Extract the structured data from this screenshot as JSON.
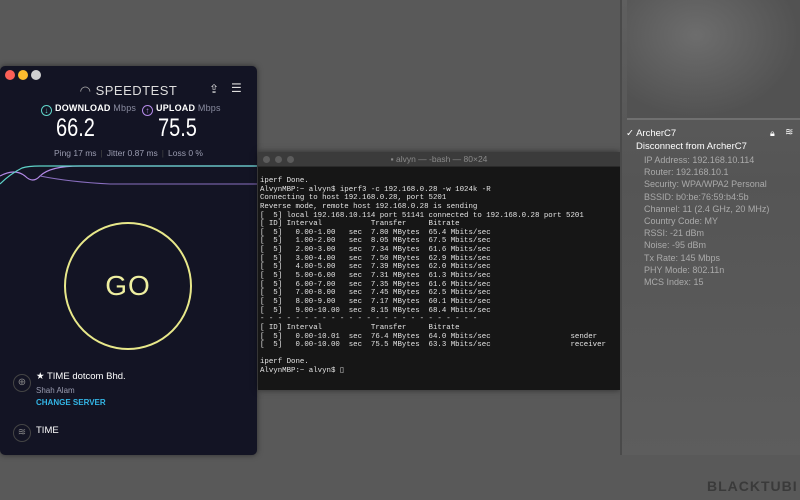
{
  "speedtest": {
    "title": "SPEEDTEST",
    "download_label": "DOWNLOAD",
    "download_unit": "Mbps",
    "download_value": "66.2",
    "upload_label": "UPLOAD",
    "upload_unit": "Mbps",
    "upload_value": "75.5",
    "ping": "Ping 17 ms",
    "jitter": "Jitter 0.87 ms",
    "loss": "Loss 0 %",
    "go_label": "GO",
    "server_name": "TIME dotcom Bhd.",
    "server_location": "Shah Alam",
    "change_server": "CHANGE SERVER",
    "isp": "TIME",
    "colors": {
      "download": "#5fd3c8",
      "upload": "#b48ae8",
      "go": "#e8e88a",
      "link": "#33b5e5"
    }
  },
  "terminal": {
    "title": "alvyn — -bash — 80×24",
    "lines": [
      "iperf Done.",
      "AlvynMBP:~ alvyn$ iperf3 -c 192.168.0.28 -w 1024k -R",
      "Connecting to host 192.168.0.28, port 5201",
      "Reverse mode, remote host 192.168.0.28 is sending",
      "[  5] local 192.168.10.114 port 51141 connected to 192.168.0.28 port 5201",
      "[ ID] Interval           Transfer     Bitrate",
      "[  5]   0.00-1.00   sec  7.80 MBytes  65.4 Mbits/sec",
      "[  5]   1.00-2.00   sec  8.05 MBytes  67.5 Mbits/sec",
      "[  5]   2.00-3.00   sec  7.34 MBytes  61.6 Mbits/sec",
      "[  5]   3.00-4.00   sec  7.50 MBytes  62.9 Mbits/sec",
      "[  5]   4.00-5.00   sec  7.39 MBytes  62.0 Mbits/sec",
      "[  5]   5.00-6.00   sec  7.31 MBytes  61.3 Mbits/sec",
      "[  5]   6.00-7.00   sec  7.35 MBytes  61.6 Mbits/sec",
      "[  5]   7.00-8.00   sec  7.45 MBytes  62.5 Mbits/sec",
      "[  5]   8.00-9.00   sec  7.17 MBytes  60.1 Mbits/sec",
      "[  5]   9.00-10.00  sec  8.15 MBytes  68.4 Mbits/sec",
      "- - - - - - - - - - - - - - - - - - - - - - - - -",
      "[ ID] Interval           Transfer     Bitrate",
      "[  5]   0.00-10.01  sec  76.4 MBytes  64.0 Mbits/sec                  sender",
      "[  5]   0.00-10.00  sec  75.5 MBytes  63.3 Mbits/sec                  receiver",
      "",
      "iperf Done.",
      "AlvynMBP:~ alvyn$ ▯"
    ]
  },
  "wifi_menu": {
    "network": "✓ ArcherC7",
    "disconnect": "Disconnect from ArcherC7",
    "details": [
      "IP Address: 192.168.10.114",
      "Router: 192.168.10.1",
      "Security: WPA/WPA2 Personal",
      "BSSID: b0:be:76:59:b4:5b",
      "Channel: 11 (2.4 GHz, 20 MHz)",
      "Country Code: MY",
      "RSSI: -21 dBm",
      "Noise: -95 dBm",
      "Tx Rate: 145 Mbps",
      "PHY Mode: 802.11n",
      "MCS Index: 15"
    ]
  },
  "watermark": "BLACKTUBI"
}
